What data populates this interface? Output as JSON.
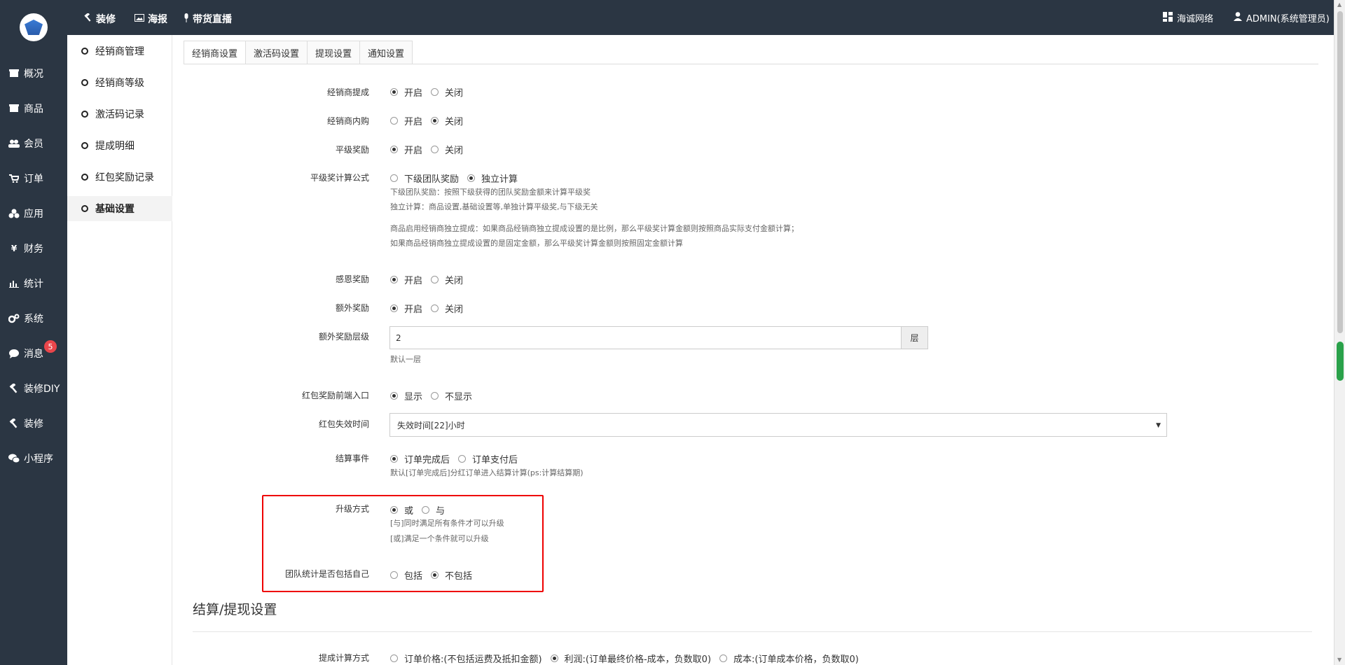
{
  "sidebar": {
    "items": [
      {
        "label": "概况",
        "icon": "box-icon"
      },
      {
        "label": "商品",
        "icon": "package-icon"
      },
      {
        "label": "会员",
        "icon": "users-icon"
      },
      {
        "label": "订单",
        "icon": "cart-icon"
      },
      {
        "label": "应用",
        "icon": "apps-icon"
      },
      {
        "label": "财务",
        "icon": "yen-icon"
      },
      {
        "label": "统计",
        "icon": "chart-icon"
      },
      {
        "label": "系统",
        "icon": "gears-icon"
      },
      {
        "label": "消息",
        "icon": "chat-icon"
      },
      {
        "label": "装修DIY",
        "icon": "hammer-icon"
      },
      {
        "label": "装修",
        "icon": "hammer-icon"
      },
      {
        "label": "小程序",
        "icon": "wechat-icon"
      }
    ],
    "message_badge": "5"
  },
  "topbar": {
    "links": [
      {
        "label": "装修",
        "icon": "hammer-icon"
      },
      {
        "label": "海报",
        "icon": "image-icon"
      },
      {
        "label": "带货直播",
        "icon": "microphone-icon"
      }
    ],
    "company": "海诚网络",
    "user": "ADMIN(系统管理员)"
  },
  "subnav": {
    "items": [
      {
        "label": "经销商管理"
      },
      {
        "label": "经销商等级"
      },
      {
        "label": "激活码记录"
      },
      {
        "label": "提成明细"
      },
      {
        "label": "红包奖励记录"
      },
      {
        "label": "基础设置"
      }
    ]
  },
  "tabs": [
    {
      "label": "经销商设置"
    },
    {
      "label": "激活码设置"
    },
    {
      "label": "提现设置"
    },
    {
      "label": "通知设置"
    }
  ],
  "form": {
    "commission": {
      "label": "经销商提成",
      "opt1": "开启",
      "opt2": "关闭"
    },
    "internal_buy": {
      "label": "经销商内购",
      "opt1": "开启",
      "opt2": "关闭"
    },
    "peer_reward": {
      "label": "平级奖励",
      "opt1": "开启",
      "opt2": "关闭"
    },
    "peer_formula": {
      "label": "平级奖计算公式",
      "opt1": "下级团队奖励",
      "opt2": "独立计算",
      "help1": "下级团队奖励：按照下级获得的团队奖励金额来计算平级奖",
      "help2": "独立计算：商品设置,基础设置等,单独计算平级奖,与下级无关",
      "help3": "商品启用经销商独立提成：如果商品经销商独立提成设置的是比例，那么平级奖计算金额则按照商品实际支付金额计算；",
      "help4": "如果商品经销商独立提成设置的是固定金额，那么平级奖计算金额则按照固定金额计算"
    },
    "gratitude_reward": {
      "label": "感恩奖励",
      "opt1": "开启",
      "opt2": "关闭"
    },
    "extra_reward": {
      "label": "额外奖励",
      "opt1": "开启",
      "opt2": "关闭"
    },
    "extra_level": {
      "label": "额外奖励层级",
      "value": "2",
      "addon": "层",
      "help": "默认一层"
    },
    "redpack_entry": {
      "label": "红包奖励前端入口",
      "opt1": "显示",
      "opt2": "不显示"
    },
    "redpack_expire": {
      "label": "红包失效时间",
      "selected": "失效时间[22]小时"
    },
    "settle_event": {
      "label": "结算事件",
      "opt1": "订单完成后",
      "opt2": "订单支付后",
      "help": "默认[订单完成后]分红订单进入结算计算(ps:计算结算期)"
    },
    "upgrade_mode": {
      "label": "升级方式",
      "opt1": "或",
      "opt2": "与",
      "help1": "[与]同时满足所有条件才可以升级",
      "help2": "[或]满足一个条件就可以升级"
    },
    "team_include_self": {
      "label": "团队统计是否包括自己",
      "opt1": "包括",
      "opt2": "不包括"
    }
  },
  "section": {
    "title": "结算/提现设置",
    "calc_label": "提成计算方式",
    "calc_opt1": "订单价格:(不包括运费及抵扣金额)",
    "calc_opt2": "利润:(订单最终价格-成本，负数取0)",
    "calc_opt3": "成本:(订单成本价格，负数取0)"
  }
}
